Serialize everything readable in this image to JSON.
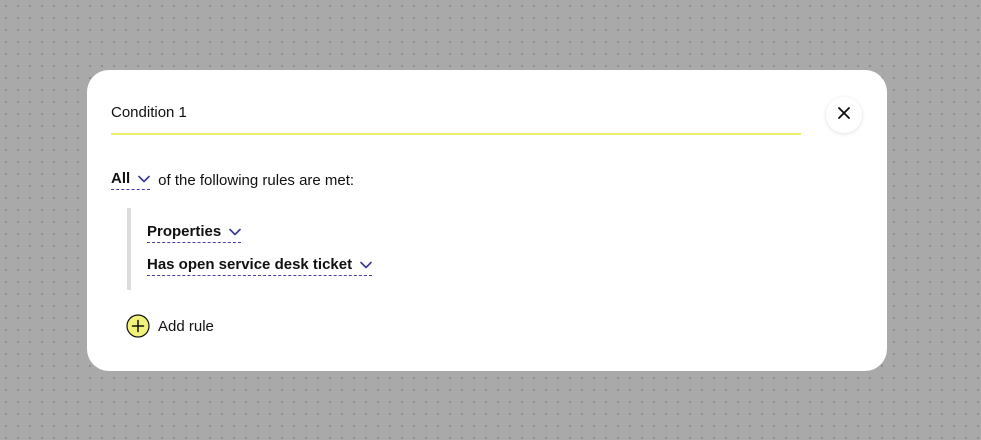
{
  "condition": {
    "title_value": "Condition 1"
  },
  "match": {
    "quantifier": "All",
    "sentence_rest": "of the following rules are met:"
  },
  "rules": [
    {
      "label": "Properties"
    },
    {
      "label": "Has open service desk ticket"
    }
  ],
  "add_rule": {
    "label": "Add rule"
  },
  "icons": {
    "close": "close-icon",
    "chevron": "chevron-down-icon",
    "add": "plus-circle-icon"
  },
  "colors": {
    "accent_yellow": "#f2f27a",
    "underline_yellow": "#eef06a",
    "dashed_underline": "#4a3fa0",
    "chevron": "#3b3a8f"
  }
}
